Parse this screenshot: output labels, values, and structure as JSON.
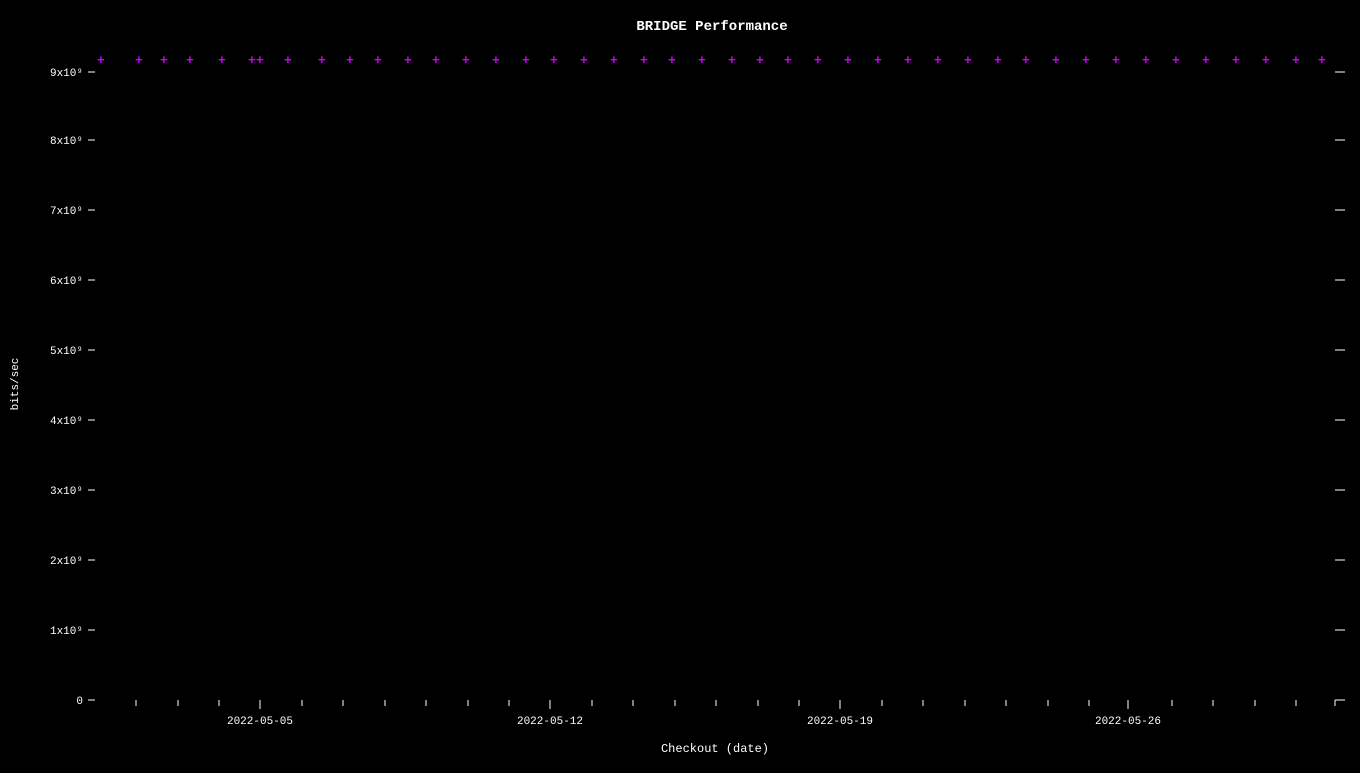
{
  "chart": {
    "title": "BRIDGE Performance",
    "x_axis_label": "Checkout (date)",
    "y_axis_label": "bits/sec",
    "x_ticks": [
      "2022-05-05",
      "2022-05-12",
      "2022-05-19",
      "2022-05-26"
    ],
    "y_ticks": [
      "0",
      "1x10⁹",
      "2x10⁹",
      "3x10⁹",
      "4x10⁹",
      "5x10⁹",
      "6x10⁹",
      "7x10⁹",
      "8x10⁹",
      "9x10⁹"
    ],
    "data_color": "#cc00ff",
    "accent_color": "#ffffff"
  }
}
